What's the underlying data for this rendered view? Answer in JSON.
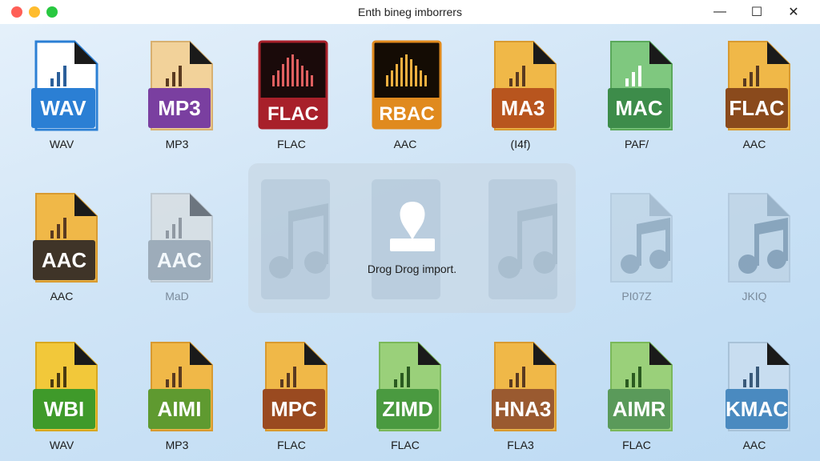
{
  "window": {
    "title": "Enth bineg imborrers",
    "controls": {
      "minimize": "—",
      "maximize": "☐",
      "close": "✕"
    }
  },
  "row1": [
    {
      "badge": "WAV",
      "label": "WAV"
    },
    {
      "badge": "MP3",
      "label": "MP3"
    },
    {
      "badge": "FLAC",
      "label": "FLAC"
    },
    {
      "badge": "RBAC",
      "label": "AAC"
    },
    {
      "badge": "MA3",
      "label": "(I4f)"
    },
    {
      "badge": "MAC",
      "label": "PAF/"
    },
    {
      "badge": "FLAC",
      "label": "AAC"
    }
  ],
  "row2": [
    {
      "badge": "AAC",
      "label": "AAC"
    },
    {
      "badge": "AAC",
      "label": "MaD"
    },
    {
      "badge": "",
      "label": "PI07Z"
    },
    {
      "badge": "",
      "label": "JKIQ"
    }
  ],
  "row3": [
    {
      "badge": "WBI",
      "label": "WAV"
    },
    {
      "badge": "AIMI",
      "label": "MP3"
    },
    {
      "badge": "MPC",
      "label": "FLAC"
    },
    {
      "badge": "ZIMD",
      "label": "FLAC"
    },
    {
      "badge": "HNA3",
      "label": "FLA3"
    },
    {
      "badge": "AIMR",
      "label": "FLAC"
    },
    {
      "badge": "KMAC",
      "label": "AAC"
    }
  ],
  "dropzone": {
    "text": "Drog Drog import."
  },
  "colors": {
    "wav_blue": "#2b7fd4",
    "mp3_purple": "#7a3fa0",
    "flac_red": "#a8202a",
    "aac_orange": "#e08a1e",
    "ma3_brown": "#b8551e",
    "mac_green": "#3d8c4a",
    "flac_brown": "#8a4a1c",
    "aac_dark": "#3f3428",
    "faded_gray": "#8c9aa6",
    "wbi_green": "#3f9a2a",
    "aimi_green": "#5f9a30",
    "mpc_brown": "#9a4a20",
    "zimd_green": "#4a9a40",
    "hna3_brown": "#9a5a30",
    "aimr_green": "#5a9a5a",
    "kmac_blue": "#4a8ac0"
  }
}
